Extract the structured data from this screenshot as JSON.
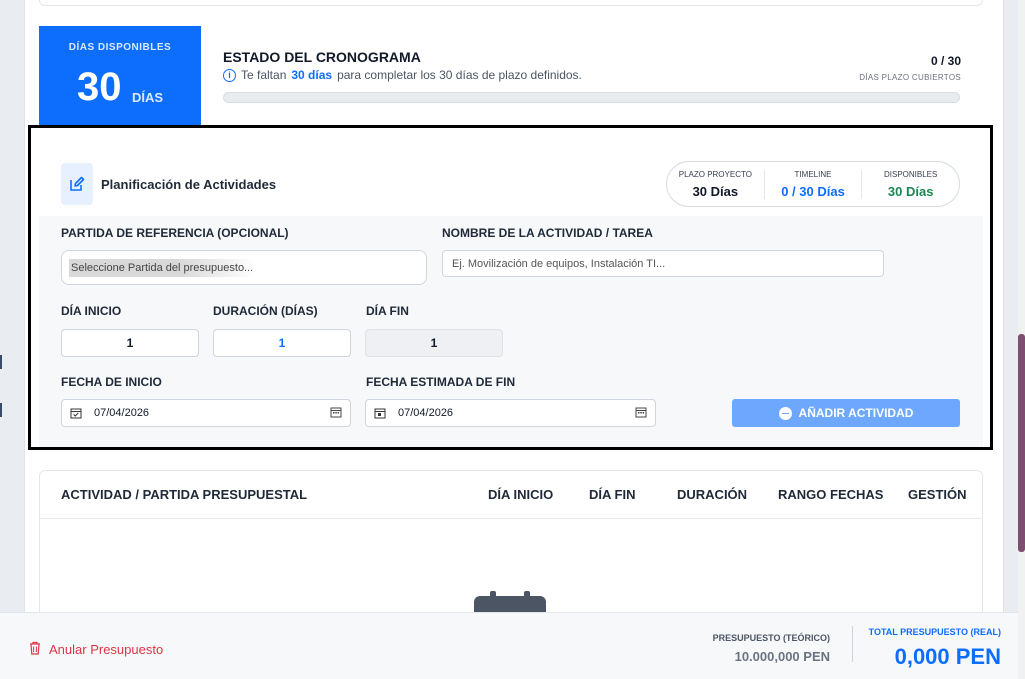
{
  "colors": {
    "primary": "#0d6efd",
    "success": "#198754",
    "danger": "#dc3545",
    "button_disabled": "#6ea8fe"
  },
  "summary": {
    "days_label": "DÍAS DISPONIBLES",
    "days_value": "30",
    "days_unit": "DÍAS",
    "title": "ESTADO DEL CRONOGRAMA",
    "info_prefix": "Te faltan",
    "info_highlight": "30 días",
    "info_suffix": "para completar los 30 días de plazo definidos.",
    "coverage": "0 / 30",
    "coverage_label": "DÍAS PLAZO CUBIERTOS",
    "progress_fraction": 0
  },
  "planning": {
    "icon": "edit-icon",
    "title": "Planificación de Actividades",
    "stats": [
      {
        "label": "PLAZO PROYECTO",
        "value": "30 Días"
      },
      {
        "label": "TIMELINE",
        "value": "0 / 30 Días"
      },
      {
        "label": "DISPONIBLES",
        "value": "30 Días"
      }
    ],
    "partida_label": "PARTIDA DE REFERENCIA (OPCIONAL)",
    "partida_value": "Seleccione Partida del presupuesto...",
    "task_label": "NOMBRE DE LA ACTIVIDAD / TAREA",
    "task_placeholder": "Ej. Movilización de equipos, Instalación TI...",
    "start_day_label": "DÍA INICIO",
    "start_day_value": "1",
    "duration_label": "DURACIÓN (DÍAS)",
    "duration_value": "1",
    "end_day_label": "DÍA FIN",
    "end_day_value": "1",
    "start_date_label": "FECHA DE INICIO",
    "start_date_value": "07/04/2026",
    "end_date_label": "FECHA ESTIMADA DE FIN",
    "end_date_value": "07/04/2026",
    "add_button": "AÑADIR ACTIVIDAD"
  },
  "table": {
    "headers": [
      "ACTIVIDAD / PARTIDA PRESUPUESTAL",
      "DÍA INICIO",
      "DÍA FIN",
      "DURACIÓN",
      "RANGO FECHAS",
      "GESTIÓN"
    ],
    "empty_icon": "calendar-icon"
  },
  "footer": {
    "cancel": "Anular Presupuesto",
    "budget_label": "PRESUPUESTO (TEÓRICO)",
    "budget_value": "10.000,000 PEN",
    "total_label": "TOTAL PRESUPUESTO (REAL)",
    "total_value": "0,000 PEN"
  }
}
